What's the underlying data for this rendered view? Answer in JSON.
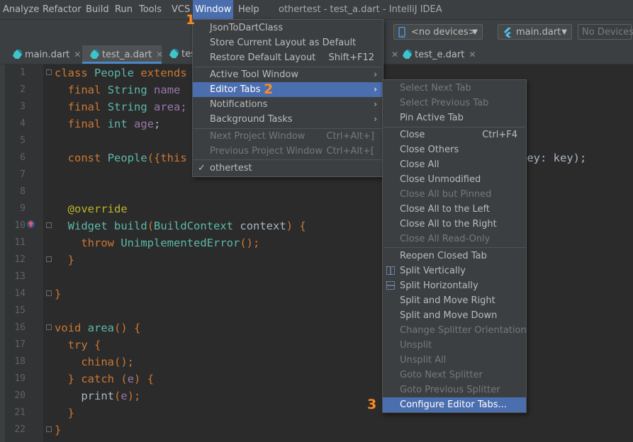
{
  "menubar": {
    "items": [
      "Analyze",
      "Refactor",
      "Build",
      "Run",
      "Tools",
      "VCS",
      "Window",
      "Help"
    ],
    "title": "othertest - test_a.dart - IntelliJ IDEA"
  },
  "toolbar": {
    "device": "<no devices>",
    "run_config": "main.dart",
    "devices_btn": "No Devices"
  },
  "tabs": [
    {
      "label": "main.dart"
    },
    {
      "label": "test_a.dart"
    },
    {
      "label": "tes"
    },
    {
      "label": "test_e.dart"
    }
  ],
  "gutter": {
    "lines": [
      "1",
      "2",
      "3",
      "4",
      "5",
      "6",
      "7",
      "8",
      "9",
      "10",
      "11",
      "12",
      "13",
      "14",
      "15",
      "16",
      "17",
      "18",
      "19",
      "20",
      "21",
      "22"
    ]
  },
  "code": {
    "l1_kw": "class",
    "l1_cls": "People",
    "l1_kw2": "extends",
    "l2_kw": "final",
    "l2_cls": "String",
    "l2_fld": "name",
    "l3_kw": "final",
    "l3_cls": "String",
    "l3_fld": "area;",
    "l4_kw": "final",
    "l4_cls": "int",
    "l4_fld": "age",
    "l4_rest": ";",
    "l6_kw": "const",
    "l6_cls": "People",
    "l6_rest": "({this",
    "l6_tail": "key: key);",
    "l9_ann": "@override",
    "l10_cls": "Widget",
    "l10_fn": "build",
    "l10_cls2": "BuildContext",
    "l10_var": "context",
    "l10_rest": ") {",
    "l11_kw": "throw",
    "l11_cls": "UnimplementedError",
    "l11_rest": "();",
    "l12": "}",
    "l14": "}",
    "l16_kw": "void",
    "l16_fn": "area",
    "l16_rest": "() {",
    "l17_kw": "try",
    "l17_rest": " {",
    "l18_fn": "china",
    "l18_rest": "();",
    "l19_a": "} ",
    "l19_kw": "catch",
    "l19_b": " (",
    "l19_var": "e",
    "l19_c": ") {",
    "l20_fn": "print",
    "l20_a": "(",
    "l20_var": "e",
    "l20_b": ");",
    "l21": "}",
    "l22": "}"
  },
  "window_menu": {
    "items": [
      {
        "label": "JsonToDartClass",
        "enabled": true
      },
      {
        "label": "Store Current Layout as Default",
        "enabled": true
      },
      {
        "label": "Restore Default Layout",
        "shortcut": "Shift+F12",
        "enabled": true
      },
      {
        "label": "Active Tool Window",
        "submenu": true,
        "enabled": true
      },
      {
        "label": "Editor Tabs",
        "submenu": true,
        "enabled": true,
        "highlighted": true
      },
      {
        "label": "Notifications",
        "submenu": true,
        "enabled": true
      },
      {
        "label": "Background Tasks",
        "submenu": true,
        "enabled": true
      },
      {
        "label": "Next Project Window",
        "shortcut": "Ctrl+Alt+]",
        "enabled": false
      },
      {
        "label": "Previous Project Window",
        "shortcut": "Ctrl+Alt+[",
        "enabled": false
      },
      {
        "label": "othertest",
        "checked": true,
        "enabled": true
      }
    ]
  },
  "editor_tabs_menu": {
    "items": [
      {
        "label": "Select Next Tab",
        "enabled": false
      },
      {
        "label": "Select Previous Tab",
        "enabled": false
      },
      {
        "label": "Pin Active Tab",
        "enabled": true
      },
      {
        "label": "Close",
        "shortcut": "Ctrl+F4",
        "enabled": true
      },
      {
        "label": "Close Others",
        "enabled": true
      },
      {
        "label": "Close All",
        "enabled": true
      },
      {
        "label": "Close Unmodified",
        "enabled": true
      },
      {
        "label": "Close All but Pinned",
        "enabled": false
      },
      {
        "label": "Close All to the Left",
        "enabled": true
      },
      {
        "label": "Close All to the Right",
        "enabled": true
      },
      {
        "label": "Close All Read-Only",
        "enabled": false
      },
      {
        "label": "Reopen Closed Tab",
        "enabled": true
      },
      {
        "label": "Split Vertically",
        "enabled": true,
        "icon": "split-vertical-icon"
      },
      {
        "label": "Split Horizontally",
        "enabled": true,
        "icon": "split-horizontal-icon"
      },
      {
        "label": "Split and Move Right",
        "enabled": true
      },
      {
        "label": "Split and Move Down",
        "enabled": true
      },
      {
        "label": "Change Splitter Orientation",
        "enabled": false
      },
      {
        "label": "Unsplit",
        "enabled": false
      },
      {
        "label": "Unsplit All",
        "enabled": false
      },
      {
        "label": "Goto Next Splitter",
        "enabled": false
      },
      {
        "label": "Goto Previous Splitter",
        "enabled": false
      },
      {
        "label": "Configure Editor Tabs...",
        "enabled": true,
        "highlighted": true
      }
    ]
  },
  "step_markers": [
    "1",
    "2",
    "3"
  ],
  "colors": {
    "accent": "#4b6eaf",
    "marker": "#ff8a1f"
  }
}
